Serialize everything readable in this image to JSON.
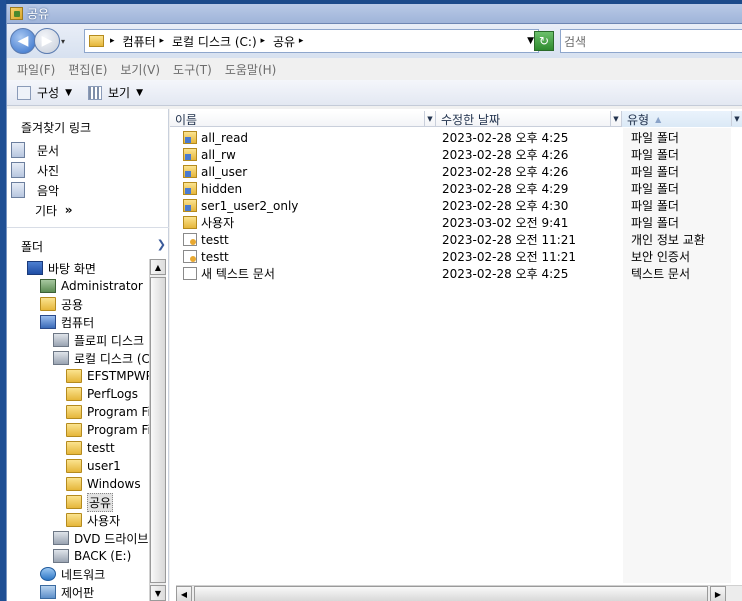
{
  "window": {
    "title": "공유"
  },
  "address": {
    "crumbs": [
      "컴퓨터",
      "로컬 디스크 (C:)",
      "공유"
    ],
    "search_placeholder": "검색"
  },
  "menu": [
    "파일(F)",
    "편집(E)",
    "보기(V)",
    "도구(T)",
    "도움말(H)"
  ],
  "toolbar": {
    "organize": "구성",
    "views": "보기"
  },
  "favorites": {
    "header": "즐겨찾기 링크",
    "items": [
      "문서",
      "사진",
      "음악"
    ],
    "more": "기타",
    "more_glyph": "»"
  },
  "folders_header": "폴더",
  "tree": [
    {
      "label": "바탕 화면",
      "icon": "desktop-icon",
      "indent": 1
    },
    {
      "label": "Administrator",
      "icon": "user-folder-icon",
      "indent": 2
    },
    {
      "label": "공용",
      "icon": "folder-icon",
      "indent": 2
    },
    {
      "label": "컴퓨터",
      "icon": "computer-icon",
      "indent": 2
    },
    {
      "label": "플로피 디스크",
      "icon": "floppy-drive-icon",
      "indent": 3
    },
    {
      "label": "로컬 디스크 (C",
      "icon": "local-disk-icon",
      "indent": 3
    },
    {
      "label": "EFSTMPWP",
      "icon": "folder-icon",
      "indent": 4
    },
    {
      "label": "PerfLogs",
      "icon": "folder-icon",
      "indent": 4
    },
    {
      "label": "Program File",
      "icon": "folder-icon",
      "indent": 4
    },
    {
      "label": "Program File",
      "icon": "folder-icon",
      "indent": 4
    },
    {
      "label": "testt",
      "icon": "folder-icon",
      "indent": 4
    },
    {
      "label": "user1",
      "icon": "folder-icon",
      "indent": 4
    },
    {
      "label": "Windows",
      "icon": "folder-icon",
      "indent": 4
    },
    {
      "label": "공유",
      "icon": "folder-icon",
      "indent": 4,
      "selected": true
    },
    {
      "label": "사용자",
      "icon": "folder-icon",
      "indent": 4
    },
    {
      "label": "DVD 드라이브",
      "icon": "dvd-drive-icon",
      "indent": 3
    },
    {
      "label": "BACK (E:)",
      "icon": "drive-icon",
      "indent": 3
    },
    {
      "label": "네트워크",
      "icon": "network-icon",
      "indent": 2
    },
    {
      "label": "제어판",
      "icon": "control-panel-icon",
      "indent": 2
    }
  ],
  "columns": {
    "name": "이름",
    "date": "수정한 날짜",
    "type": "유형"
  },
  "files": [
    {
      "name": "all_read",
      "date": "2023-02-28 오후 4:25",
      "type": "파일 폴더",
      "icon": "shared-folder-icon"
    },
    {
      "name": "all_rw",
      "date": "2023-02-28 오후 4:26",
      "type": "파일 폴더",
      "icon": "shared-folder-icon"
    },
    {
      "name": "all_user",
      "date": "2023-02-28 오후 4:26",
      "type": "파일 폴더",
      "icon": "shared-folder-icon"
    },
    {
      "name": "hidden",
      "date": "2023-02-28 오후 4:29",
      "type": "파일 폴더",
      "icon": "shared-folder-icon"
    },
    {
      "name": "ser1_user2_only",
      "date": "2023-02-28 오후 4:30",
      "type": "파일 폴더",
      "icon": "shared-folder-icon"
    },
    {
      "name": "사용자",
      "date": "2023-03-02 오전 9:41",
      "type": "파일 폴더",
      "icon": "folder-icon"
    },
    {
      "name": "testt",
      "date": "2023-02-28 오전 11:21",
      "type": "개인 정보 교환",
      "icon": "pfx-file-icon"
    },
    {
      "name": "testt",
      "date": "2023-02-28 오전 11:21",
      "type": "보안 인증서",
      "icon": "certificate-file-icon"
    },
    {
      "name": "새 텍스트 문서",
      "date": "2023-02-28 오후 4:25",
      "type": "텍스트 문서",
      "icon": "text-document-icon"
    }
  ]
}
